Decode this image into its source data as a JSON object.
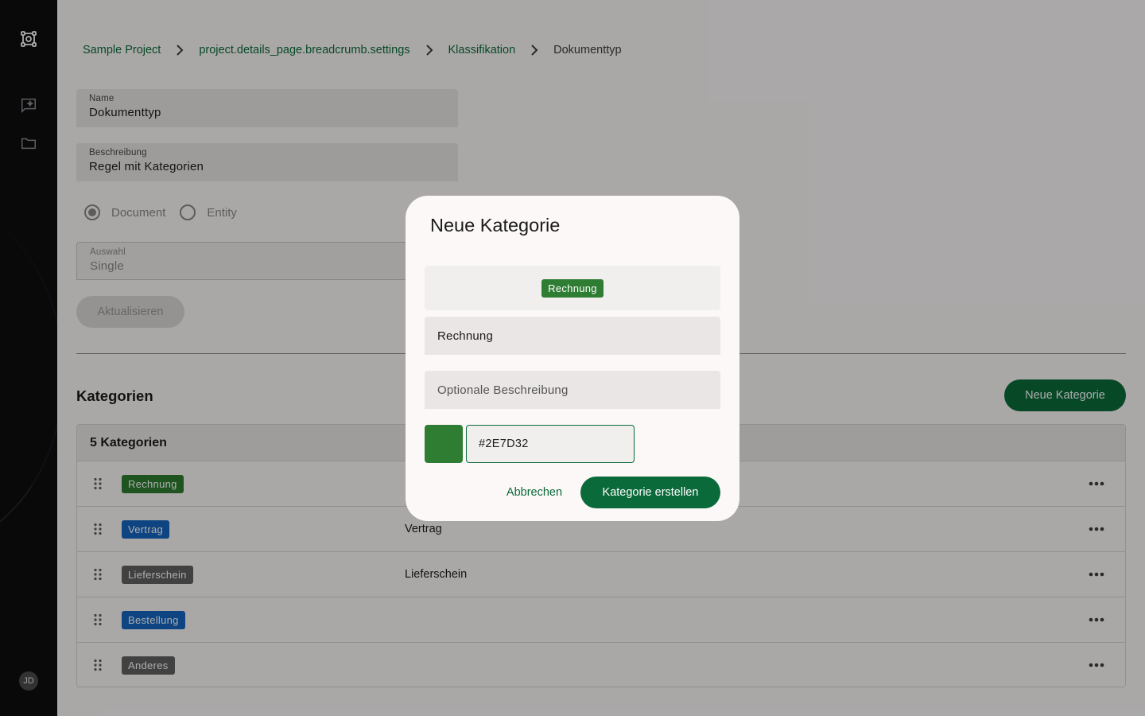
{
  "breadcrumb": {
    "items": [
      "Sample Project",
      "project.details_page.breadcrumb.settings",
      "Klassifikation"
    ],
    "current": "Dokumenttyp"
  },
  "form": {
    "name_label": "Name",
    "name_value": "Dokumenttyp",
    "description_label": "Beschreibung",
    "description_value": "Regel mit Kategorien",
    "type_options": [
      "Document",
      "Entity"
    ],
    "type_selected": "Document",
    "selection_label": "Auswahl",
    "selection_value": "Single",
    "update_button": "Aktualisieren"
  },
  "categories": {
    "title": "Kategorien",
    "new_button": "Neue Kategorie",
    "count_label": "5 Kategorien",
    "rows": [
      {
        "name": "Rechnung",
        "description": "",
        "color": "#2e7d32"
      },
      {
        "name": "Vertrag",
        "description": "Vertrag",
        "color": "#1565c0"
      },
      {
        "name": "Lieferschein",
        "description": "Lieferschein",
        "color": "#616161"
      },
      {
        "name": "Bestellung",
        "description": "",
        "color": "#1565c0"
      },
      {
        "name": "Anderes",
        "description": "",
        "color": "#616161"
      }
    ]
  },
  "dialog": {
    "title": "Neue Kategorie",
    "preview_tag": "Rechnung",
    "name_value": "Rechnung",
    "description_placeholder": "Optionale Beschreibung",
    "color_hex": "#2E7D32",
    "cancel_button": "Abbrechen",
    "create_button": "Kategorie erstellen"
  },
  "user": {
    "initials": "JD"
  },
  "sidebar": {
    "icons": [
      "logo-icon",
      "chat-sparkle-icon",
      "folder-icon"
    ]
  },
  "colors": {
    "primary": "#0b6a3a",
    "sidebar_bg": "#0e0e10"
  }
}
